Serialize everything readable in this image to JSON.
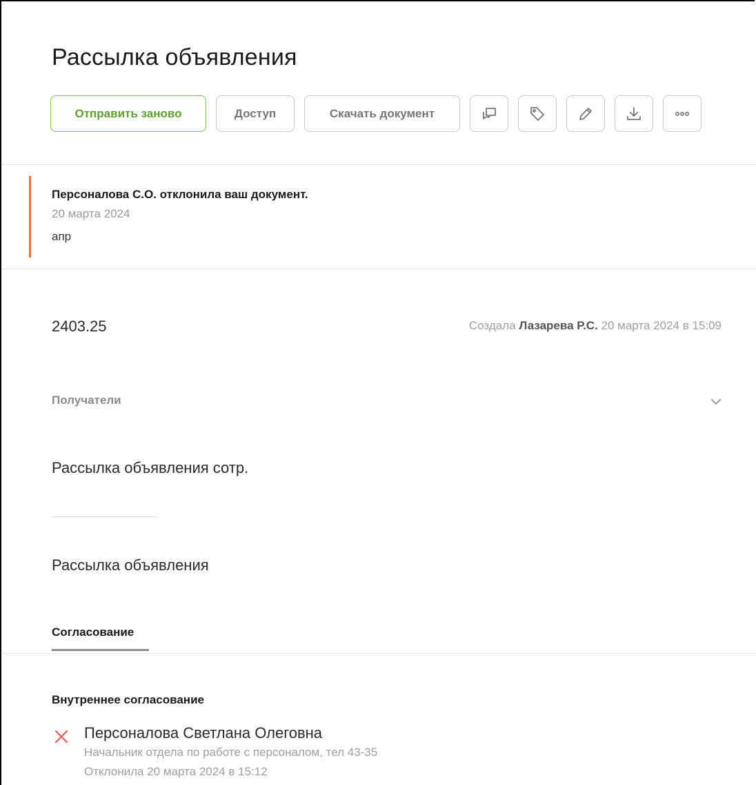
{
  "page": {
    "title": "Рассылка объявления"
  },
  "toolbar": {
    "resend_label": "Отправить заново",
    "access_label": "Доступ",
    "download_doc_label": "Скачать документ",
    "icons": [
      "comment-icon",
      "tag-icon",
      "edit-icon",
      "download-icon",
      "more-icon"
    ]
  },
  "notice": {
    "title": "Персоналова С.О. отклонила ваш документ.",
    "date": "20 марта 2024",
    "comment": "апр",
    "accent_color": "#e9743a"
  },
  "document": {
    "number": "2403.25",
    "created_prefix": "Создала",
    "created_author": "Лазарева Р.С.",
    "created_when": "20 марта 2024 в 15:09"
  },
  "recipients": {
    "label": "Получатели",
    "value": "Рассылка объявления сотр."
  },
  "description": "Рассылка объявления",
  "tabs": {
    "active": "Согласование"
  },
  "approval": {
    "section_title": "Внутреннее согласование",
    "approver": {
      "name": "Персоналова Светлана Олеговна",
      "role": "Начальник отдела по работе с персоналом, тел 43-35",
      "status": "Отклонила 20 марта 2024 в 15:12",
      "status_icon": "reject-icon",
      "status_color": "#e35b5b"
    }
  },
  "colors": {
    "primary_green": "#5e9f31",
    "primary_border": "#7fbf4a"
  }
}
